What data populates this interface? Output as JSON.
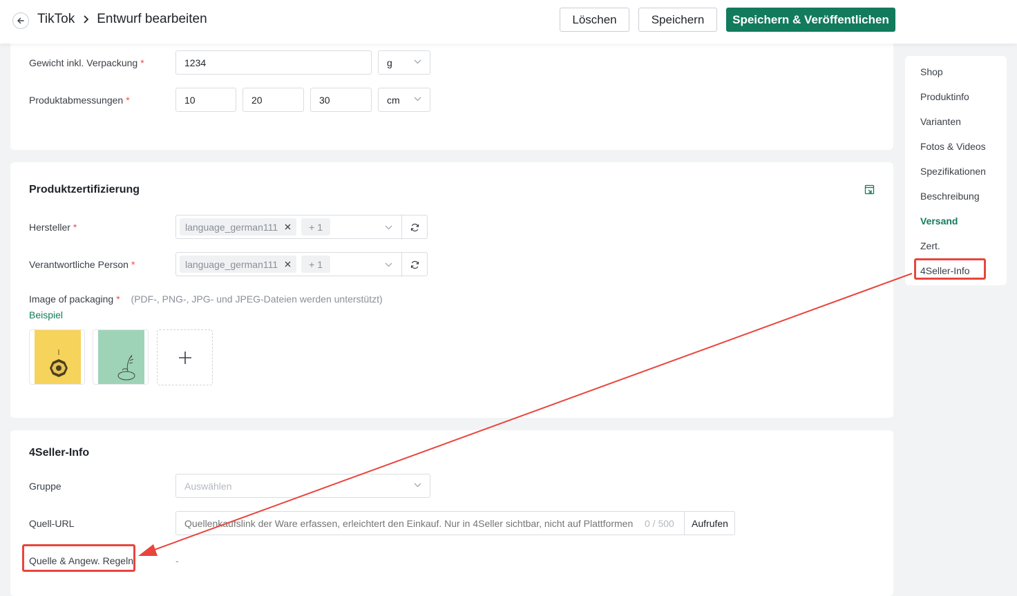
{
  "header": {
    "breadcrumb": {
      "root": "TikTok",
      "current": "Entwurf bearbeiten"
    },
    "buttons": {
      "delete": "Löschen",
      "save": "Speichern",
      "save_publish": "Speichern & Veröffentlichen"
    }
  },
  "shipping": {
    "weight": {
      "label": "Gewicht inkl. Verpackung",
      "required_mark": "*",
      "value": "1234",
      "unit": "g"
    },
    "dimensions": {
      "label": "Produktabmessungen",
      "required_mark": "*",
      "length": "10",
      "width": "20",
      "height": "30",
      "unit": "cm"
    }
  },
  "certification": {
    "title": "Produktzertifizierung",
    "manufacturer": {
      "label": "Hersteller",
      "required_mark": "*",
      "tag": "language_german111",
      "more": "+ 1"
    },
    "responsible": {
      "label": "Verantwortliche Person",
      "required_mark": "*",
      "tag": "language_german111",
      "more": "+ 1"
    },
    "packaging": {
      "label": "Image of packaging",
      "required_mark": "*",
      "hint": "(PDF-, PNG-, JPG- und JPEG-Dateien werden unterstützt)",
      "example_link": "Beispiel",
      "images": [
        "packaging-image-yellow",
        "packaging-image-green"
      ]
    }
  },
  "seller_info": {
    "title": "4Seller-Info",
    "group": {
      "label": "Gruppe",
      "placeholder": "Auswählen"
    },
    "source_url": {
      "label": "Quell-URL",
      "placeholder": "Quellenkaufslink der Ware erfassen, erleichtert den Einkauf. Nur in 4Seller sichtbar, nicht auf Plattformen",
      "counter": "0 / 500",
      "open_button": "Aufrufen"
    },
    "source_rules": {
      "label": "Quelle & Angew. Regeln",
      "value": "-"
    }
  },
  "sidenav": {
    "items": [
      "Shop",
      "Produktinfo",
      "Varianten",
      "Fotos & Videos",
      "Spezifikationen",
      "Beschreibung",
      "Versand",
      "Zert.",
      "4Seller-Info"
    ],
    "active": "Versand"
  },
  "colors": {
    "primary": "#127b5c",
    "annotation": "#e8453c",
    "required": "#f24b4b"
  },
  "icons": [
    "back-arrow-icon",
    "breadcrumb-chevron-icon",
    "chevron-down-icon",
    "close-icon",
    "refresh-icon",
    "plus-icon",
    "export-icon"
  ]
}
